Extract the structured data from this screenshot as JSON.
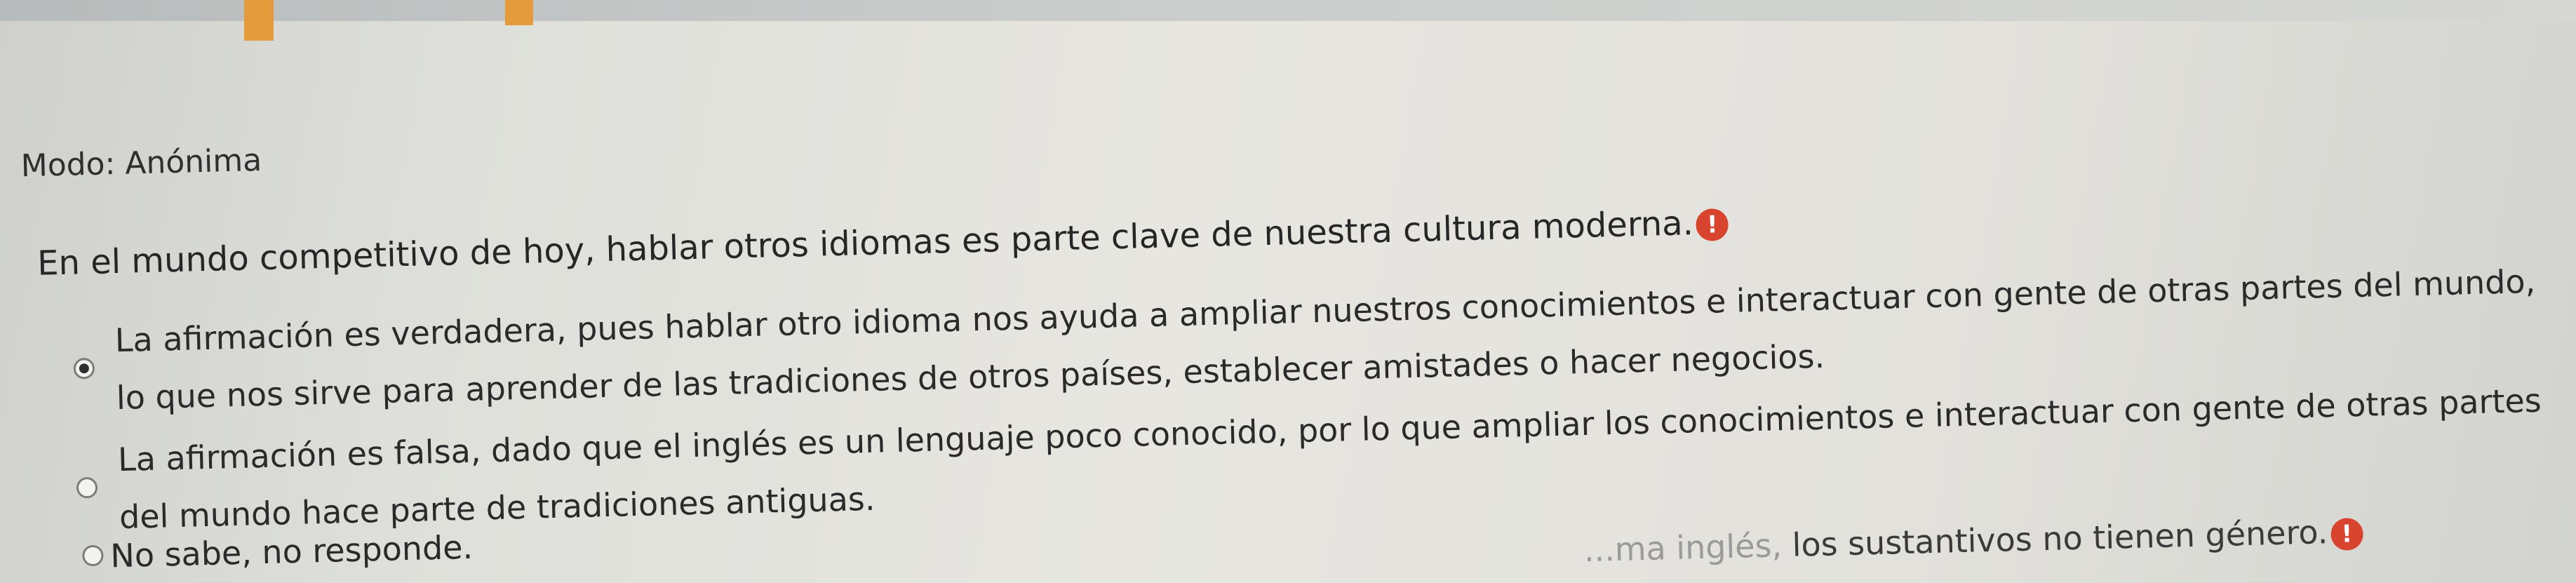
{
  "header": {
    "mode_label": "Modo: Anónima"
  },
  "question": {
    "text": "En el mundo competitivo de hoy, hablar otros idiomas es parte clave de nuestra cultura moderna.",
    "alert_icon_glyph": "!"
  },
  "options": [
    {
      "text": "La afirmación es verdadera, pues hablar otro idioma nos ayuda a ampliar nuestros conocimientos e interactuar con gente de otras partes del mundo, lo que nos sirve para aprender de las tradiciones de otros países, establecer amistades o hacer negocios.",
      "selected": true
    },
    {
      "text": "La afirmación es falsa, dado que el inglés es un lenguaje poco conocido, por lo que ampliar los conocimientos e interactuar con gente de otras partes del mundo hace parte de tradiciones antiguas.",
      "selected": false
    },
    {
      "text": "No sabe, no responde.",
      "selected": false
    }
  ],
  "next_question": {
    "prefix": "...ma inglés,",
    "text": "los sustantivos no tienen género.",
    "alert_icon_glyph": "!"
  },
  "colors": {
    "alert": "#d9442e",
    "accent_top": "#e39b3c"
  }
}
